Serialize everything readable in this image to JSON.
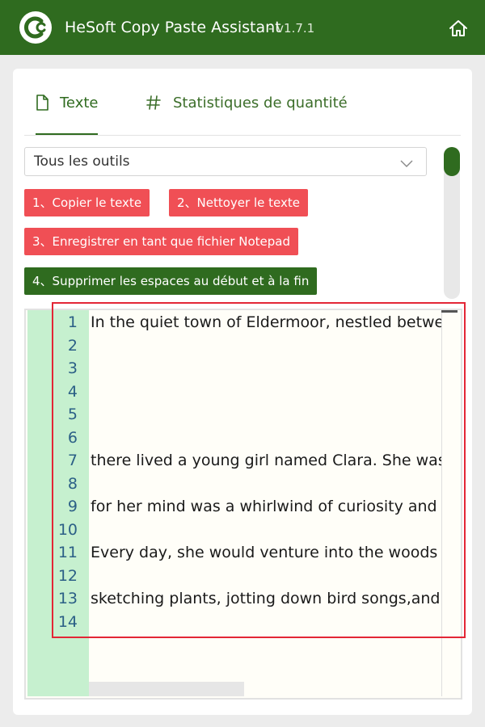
{
  "app": {
    "title": "HeSoft Copy Paste Assistant",
    "version": "- v1.7.1",
    "accent_color": "#2f6b1f",
    "logo_icon": "copy-c-logo",
    "home_icon": "home-icon"
  },
  "tabs": [
    {
      "label": "Texte",
      "icon": "document-icon",
      "active": true
    },
    {
      "label": "Statistiques de quantité",
      "icon": "hash-icon",
      "active": false
    }
  ],
  "tool_select": {
    "value": "Tous les outils"
  },
  "buttons": [
    {
      "label": "1、Copier le texte",
      "color": "#f04f55"
    },
    {
      "label": "2、Nettoyer le texte",
      "color": "#f04f55"
    },
    {
      "label": "3、Enregistrer en tant que fichier Notepad",
      "color": "#f04f55"
    },
    {
      "label": "4、Supprimer les espaces au début et à la fin",
      "color": "#2f6b1f"
    }
  ],
  "editor": {
    "lines": [
      {
        "num": "1",
        "text": "In the quiet town of Eldermoor, nestled betwe"
      },
      {
        "num": "2",
        "text": ""
      },
      {
        "num": "3",
        "text": ""
      },
      {
        "num": "4",
        "text": ""
      },
      {
        "num": "5",
        "text": ""
      },
      {
        "num": "6",
        "text": ""
      },
      {
        "num": "7",
        "text": "there lived a young girl named Clara. She was"
      },
      {
        "num": "8",
        "text": ""
      },
      {
        "num": "9",
        "text": "for her mind was a whirlwind of curiosity and"
      },
      {
        "num": "10",
        "text": ""
      },
      {
        "num": "11",
        "text": "Every day, she would venture into the woods"
      },
      {
        "num": "12",
        "text": ""
      },
      {
        "num": "13",
        "text": "sketching plants, jotting down bird songs,and"
      },
      {
        "num": "14",
        "text": ""
      }
    ]
  }
}
